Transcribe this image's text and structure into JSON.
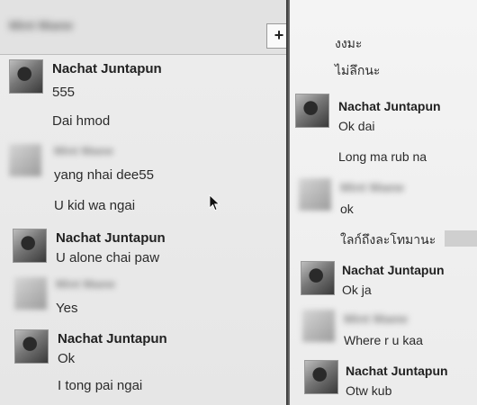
{
  "left_panel": {
    "header_contact_name": "Mint Maew",
    "plus_label": "+",
    "messages": [
      {
        "sender": "Nachat Juntapun",
        "text": "555"
      },
      {
        "text": "Dai hmod"
      },
      {
        "sender": "Mint Maew",
        "text": "yang nhai dee55"
      },
      {
        "text": "U kid wa ngai"
      },
      {
        "sender": "Nachat Juntapun",
        "text": "U alone chai paw"
      },
      {
        "sender": "Mint Maew",
        "text": "Yes"
      },
      {
        "sender": "Nachat Juntapun",
        "text": "Ok"
      },
      {
        "text": "I tong pai ngai"
      }
    ]
  },
  "right_panel": {
    "messages": [
      {
        "text": "งงมะ"
      },
      {
        "text": "ไม่ลึกนะ"
      },
      {
        "sender": "Nachat Juntapun",
        "text": "Ok dai"
      },
      {
        "text": "Long ma rub na"
      },
      {
        "sender": "Mint Maew",
        "text": "ok"
      },
      {
        "text": "ใลก์ถึงละโทมานะ"
      },
      {
        "sender": "Nachat Juntapun",
        "text": "Ok ja"
      },
      {
        "sender": "Mint Maew",
        "text": "Where r u kaa"
      },
      {
        "sender": "Nachat Juntapun",
        "text": "Otw kub"
      }
    ]
  }
}
